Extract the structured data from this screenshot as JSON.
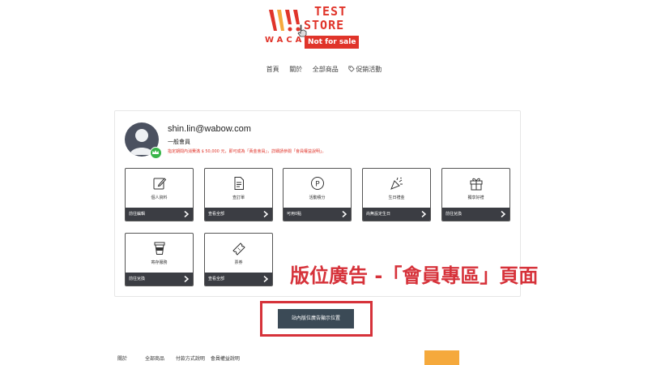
{
  "logo": {
    "brand_small": "WACA",
    "line1": "TEST",
    "line2": "STORE",
    "badge": "Not for sale"
  },
  "nav": {
    "items": [
      "首頁",
      "關於",
      "全部商品",
      "促銷活動"
    ]
  },
  "member": {
    "email": "shin.lin@wabow.com",
    "level": "一般會員",
    "hint": "指定期間內消費滿 $ 50,000 元，即可成為「黃金會員」，詳細請參閱「會員權益說明」。"
  },
  "tiles": [
    {
      "label": "個人資料",
      "action": "前往編輯"
    },
    {
      "label": "查訂單",
      "action": "查看全部"
    },
    {
      "label": "活動積分",
      "action": "可用0點"
    },
    {
      "label": "生日禮金",
      "action": "尚無設定生日"
    },
    {
      "label": "獨享好禮",
      "action": "前往兌換"
    },
    {
      "label": "寄存服務",
      "action": "前往兌換"
    },
    {
      "label": "票券",
      "action": "查看全部"
    }
  ],
  "ad": {
    "title": "版位廣告 -「會員專區」頁面",
    "button": "站內版位廣告顯示位置"
  },
  "footer": {
    "items": [
      "關於",
      "全部商品",
      "付款方式說明",
      "會員權益說明"
    ]
  },
  "colors": {
    "brand_red": "#e0342a",
    "ad_red": "#d6323a",
    "tile_bar": "#3b3d43",
    "ad_button": "#3b4a56",
    "crown_green": "#39b54a",
    "footer_accent": "#f5a93c"
  }
}
